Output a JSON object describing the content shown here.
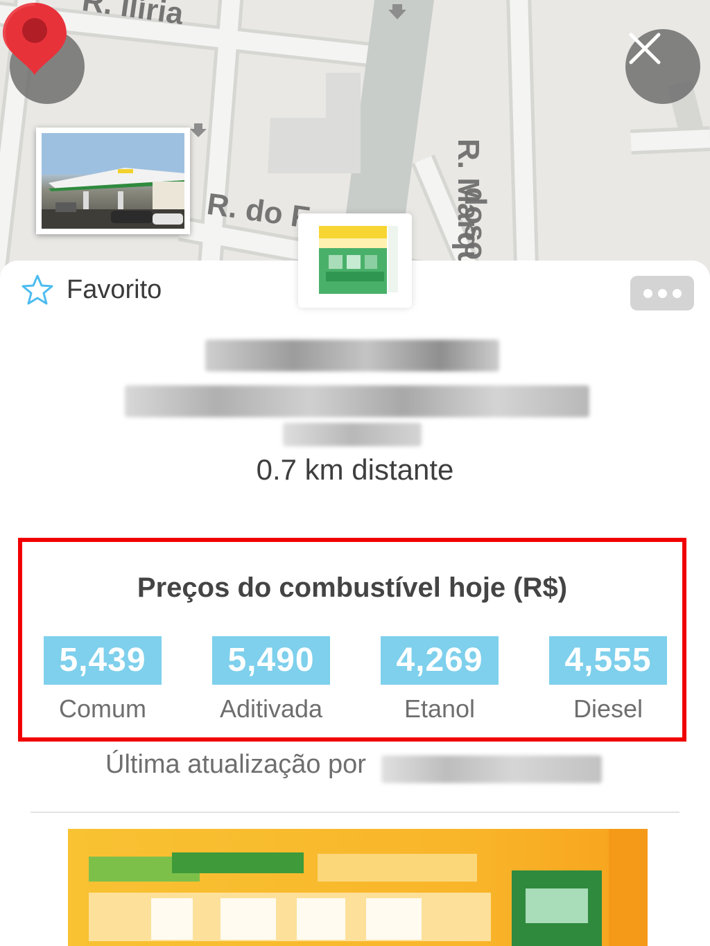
{
  "map": {
    "streets": [
      "R. Ilíria",
      "R. do F",
      "R. Marquês d",
      "doso"
    ]
  },
  "header": {
    "back_icon": "chevron-left-icon",
    "close_icon": "close-icon"
  },
  "place": {
    "favorite_label": "Favorito",
    "distance": "0.7 km distante"
  },
  "fuel_prices": {
    "title": "Preços do combustível hoje (R$)",
    "items": [
      {
        "value": "5,439",
        "label": "Comum"
      },
      {
        "value": "5,490",
        "label": "Aditivada"
      },
      {
        "value": "4,269",
        "label": "Etanol"
      },
      {
        "value": "4,555",
        "label": "Diesel"
      }
    ],
    "last_update_prefix": "Última atualização por"
  },
  "colors": {
    "highlight_border": "#f00000",
    "price_badge": "#7ed0ec",
    "pin": "#e8323a",
    "favorite_star": "#4cbcef"
  }
}
